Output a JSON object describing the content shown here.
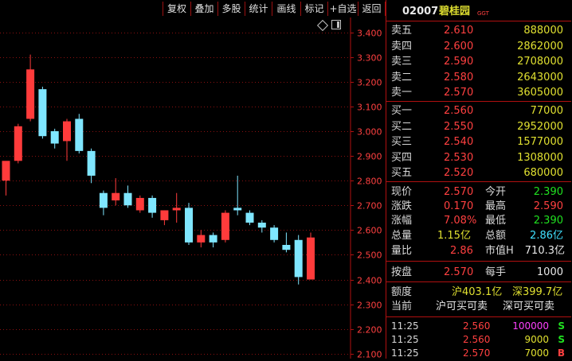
{
  "toolbar": {
    "buttons": [
      "复权",
      "叠加",
      "多股",
      "统计",
      "画线",
      "标记",
      "+自选",
      "返回"
    ]
  },
  "stock": {
    "code": "02007",
    "name": "碧桂园",
    "tag": "GGT"
  },
  "chart_data": {
    "type": "candlestick",
    "y_ticks": [
      "3.400",
      "3.300",
      "3.200",
      "3.100",
      "3.000",
      "2.900",
      "2.800",
      "2.700",
      "2.600",
      "2.500",
      "2.400",
      "2.300",
      "2.200",
      "2.100"
    ],
    "ylim": [
      2.08,
      3.46
    ],
    "candles": [
      {
        "o": 2.8,
        "h": 2.84,
        "l": 2.74,
        "c": 2.88
      },
      {
        "o": 2.88,
        "h": 3.03,
        "l": 2.87,
        "c": 3.02
      },
      {
        "o": 3.05,
        "h": 3.31,
        "l": 3.04,
        "c": 3.25
      },
      {
        "o": 3.17,
        "h": 3.18,
        "l": 2.97,
        "c": 2.98
      },
      {
        "o": 3.0,
        "h": 3.01,
        "l": 2.93,
        "c": 2.95
      },
      {
        "o": 2.96,
        "h": 3.05,
        "l": 2.88,
        "c": 3.04
      },
      {
        "o": 3.05,
        "h": 3.07,
        "l": 2.91,
        "c": 2.92
      },
      {
        "o": 2.92,
        "h": 2.93,
        "l": 2.79,
        "c": 2.82
      },
      {
        "o": 2.75,
        "h": 2.76,
        "l": 2.66,
        "c": 2.69
      },
      {
        "o": 2.72,
        "h": 2.81,
        "l": 2.7,
        "c": 2.75
      },
      {
        "o": 2.75,
        "h": 2.78,
        "l": 2.69,
        "c": 2.7
      },
      {
        "o": 2.68,
        "h": 2.74,
        "l": 2.67,
        "c": 2.73
      },
      {
        "o": 2.73,
        "h": 2.74,
        "l": 2.65,
        "c": 2.67
      },
      {
        "o": 2.64,
        "h": 2.68,
        "l": 2.62,
        "c": 2.68
      },
      {
        "o": 2.68,
        "h": 2.75,
        "l": 2.63,
        "c": 2.69
      },
      {
        "o": 2.69,
        "h": 2.71,
        "l": 2.54,
        "c": 2.55
      },
      {
        "o": 2.55,
        "h": 2.6,
        "l": 2.53,
        "c": 2.58
      },
      {
        "o": 2.58,
        "h": 2.59,
        "l": 2.53,
        "c": 2.55
      },
      {
        "o": 2.56,
        "h": 2.68,
        "l": 2.55,
        "c": 2.67
      },
      {
        "o": 2.69,
        "h": 2.82,
        "l": 2.66,
        "c": 2.68
      },
      {
        "o": 2.67,
        "h": 2.68,
        "l": 2.62,
        "c": 2.63
      },
      {
        "o": 2.63,
        "h": 2.64,
        "l": 2.59,
        "c": 2.61
      },
      {
        "o": 2.61,
        "h": 2.62,
        "l": 2.55,
        "c": 2.56
      },
      {
        "o": 2.54,
        "h": 2.59,
        "l": 2.51,
        "c": 2.52
      },
      {
        "o": 2.56,
        "h": 2.58,
        "l": 2.38,
        "c": 2.41
      },
      {
        "o": 2.4,
        "h": 2.59,
        "l": 2.4,
        "c": 2.57
      }
    ]
  },
  "quote": {
    "asks": [
      {
        "label": "卖五",
        "price": "2.610",
        "volume": "888000"
      },
      {
        "label": "卖四",
        "price": "2.600",
        "volume": "2862000"
      },
      {
        "label": "卖三",
        "price": "2.590",
        "volume": "2708000"
      },
      {
        "label": "卖二",
        "price": "2.580",
        "volume": "2643000"
      },
      {
        "label": "卖一",
        "price": "2.570",
        "volume": "3605000"
      }
    ],
    "bids": [
      {
        "label": "买一",
        "price": "2.560",
        "volume": "77000"
      },
      {
        "label": "买二",
        "price": "2.550",
        "volume": "2952000"
      },
      {
        "label": "买三",
        "price": "2.540",
        "volume": "1577000"
      },
      {
        "label": "买四",
        "price": "2.530",
        "volume": "1308000"
      },
      {
        "label": "买五",
        "price": "2.520",
        "volume": "680000"
      }
    ],
    "stats": {
      "now_label": "现价",
      "now": "2.570",
      "open_label": "今开",
      "open": "2.390",
      "chg_label": "涨跌",
      "chg": "0.170",
      "high_label": "最高",
      "high": "2.590",
      "pct_label": "涨幅",
      "pct": "7.08%",
      "low_label": "最低",
      "low": "2.390",
      "vol_label": "总量",
      "vol": "1.15亿",
      "amt_label": "总额",
      "amt": "2.86亿",
      "ratio_label": "量比",
      "ratio": "2.86",
      "mcap_label": "市值H",
      "mcap": "710.3亿"
    },
    "order": {
      "label": "按盘",
      "value": "2.570",
      "lot_label": "每手",
      "lot": "1000"
    },
    "quota": {
      "label": "额度",
      "sh": "沪403.1亿",
      "sz": "深399.7亿",
      "cur_label": "当前",
      "sh_status": "沪可买可卖",
      "sz_status": "深可买可卖"
    },
    "ticks": [
      {
        "time": "11:25",
        "price": "2.560",
        "vol": "100000",
        "side": "S"
      },
      {
        "time": "11:25",
        "price": "2.560",
        "vol": "9000",
        "side": "S"
      },
      {
        "time": "11:25",
        "price": "2.570",
        "vol": "7000",
        "side": "B"
      }
    ]
  },
  "colors": {
    "up": "#ff3b3b",
    "down": "#7fe6ff",
    "grid": "#8a1010",
    "frame": "#b01010"
  }
}
